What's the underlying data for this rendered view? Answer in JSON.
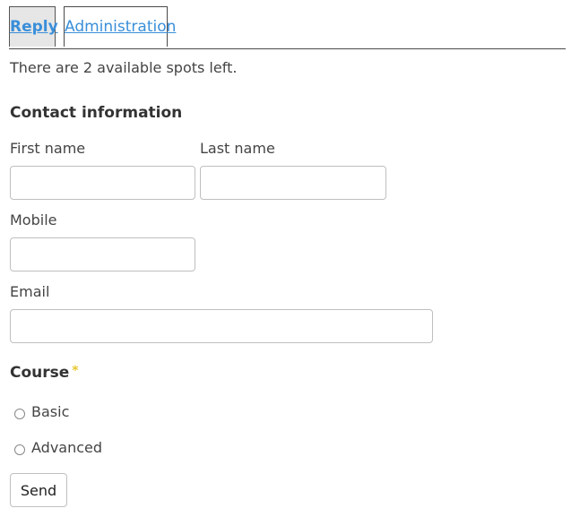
{
  "tabs": {
    "reply": "Reply",
    "administration": "Administration"
  },
  "notice": "There are 2 available spots left.",
  "contact": {
    "title": "Contact information",
    "first_name_label": "First name",
    "first_name_value": "",
    "last_name_label": "Last name",
    "last_name_value": "",
    "mobile_label": "Mobile",
    "mobile_value": "",
    "email_label": "Email",
    "email_value": ""
  },
  "course": {
    "title": "Course",
    "required_mark": "*",
    "options": [
      "Basic",
      "Advanced"
    ]
  },
  "send_label": "Send",
  "colors": {
    "link": "#3a8fd9",
    "required_star": "#e8c82e",
    "active_tab_bg": "#e6e6e6"
  }
}
